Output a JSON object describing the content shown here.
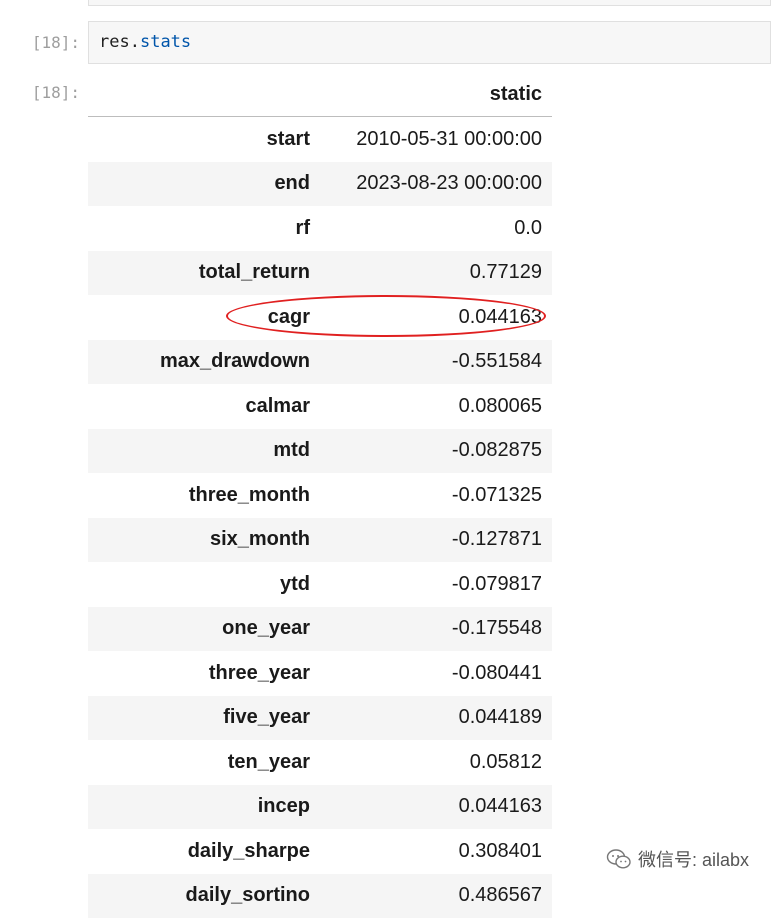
{
  "cells": {
    "input_prompt": "[18]:",
    "output_prompt": "[18]:",
    "code_object": "res",
    "code_dot": ".",
    "code_attr": "stats"
  },
  "table": {
    "column_header": "static",
    "rows": [
      {
        "label": "start",
        "value": "2010-05-31 00:00:00"
      },
      {
        "label": "end",
        "value": "2023-08-23 00:00:00"
      },
      {
        "label": "rf",
        "value": "0.0"
      },
      {
        "label": "total_return",
        "value": "0.77129"
      },
      {
        "label": "cagr",
        "value": "0.044163"
      },
      {
        "label": "max_drawdown",
        "value": "-0.551584"
      },
      {
        "label": "calmar",
        "value": "0.080065"
      },
      {
        "label": "mtd",
        "value": "-0.082875"
      },
      {
        "label": "three_month",
        "value": "-0.071325"
      },
      {
        "label": "six_month",
        "value": "-0.127871"
      },
      {
        "label": "ytd",
        "value": "-0.079817"
      },
      {
        "label": "one_year",
        "value": "-0.175548"
      },
      {
        "label": "three_year",
        "value": "-0.080441"
      },
      {
        "label": "five_year",
        "value": "0.044189"
      },
      {
        "label": "ten_year",
        "value": "0.05812"
      },
      {
        "label": "incep",
        "value": "0.044163"
      },
      {
        "label": "daily_sharpe",
        "value": "0.308401"
      },
      {
        "label": "daily_sortino",
        "value": "0.486567"
      }
    ]
  },
  "annotation": {
    "highlight_color": "#e02020",
    "highlighted_row": "cagr"
  },
  "watermark": {
    "icon": "wechat-icon",
    "text": "微信号: ailabx"
  }
}
